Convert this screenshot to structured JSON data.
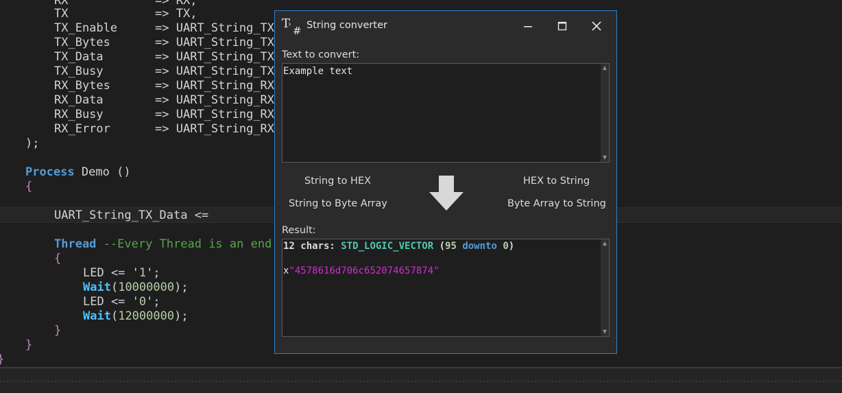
{
  "editor": {
    "code": {
      "rx": "RX",
      "tx": "TX",
      "tx_enable": "TX_Enable",
      "tx_bytes": "TX_Bytes",
      "tx_data": "TX_Data",
      "tx_busy": "TX_Busy",
      "rx_bytes": "RX_Bytes",
      "rx_data": "RX_Data",
      "rx_busy": "RX_Busy",
      "rx_error": "RX_Error",
      "arrow": "=>",
      "rx_val": "RX,",
      "tx_val": "TX,",
      "uart_tx": "UART_String_TX",
      "uart_rx": "UART_String_RX",
      "close_paren": ");",
      "process_kw": "Process",
      "process_name": "Demo ()",
      "open_brace": "{",
      "close_brace": "}",
      "assign_line": "UART_String_TX_Data <=",
      "thread_kw": "Thread",
      "thread_comment": "--Every Thread is an end",
      "led": "LED <= '",
      "one": "1",
      "zero": "0",
      "quote_semi": "';",
      "wait": "Wait",
      "open_p": "(",
      "close_p_semi": ");",
      "wait1": "10000000",
      "wait2": "12000000",
      "last_brace": "}"
    }
  },
  "dialog": {
    "title": "String converter",
    "input_label": "Text to convert:",
    "input_value": "Example text",
    "buttons": {
      "string_to_hex": "String to HEX",
      "hex_to_string": "HEX to String",
      "string_to_byte_array": "String to Byte Array",
      "byte_array_to_string": "Byte Array to String"
    },
    "result_label": "Result:",
    "result": {
      "count": "12 chars:",
      "type": "STD_LOGIC_VECTOR",
      "open": "(",
      "hi": "95",
      "downto": "downto",
      "lo": "0",
      "close": ")",
      "prefix": "x",
      "hex": "\"4578616d706c652074657874\""
    }
  }
}
